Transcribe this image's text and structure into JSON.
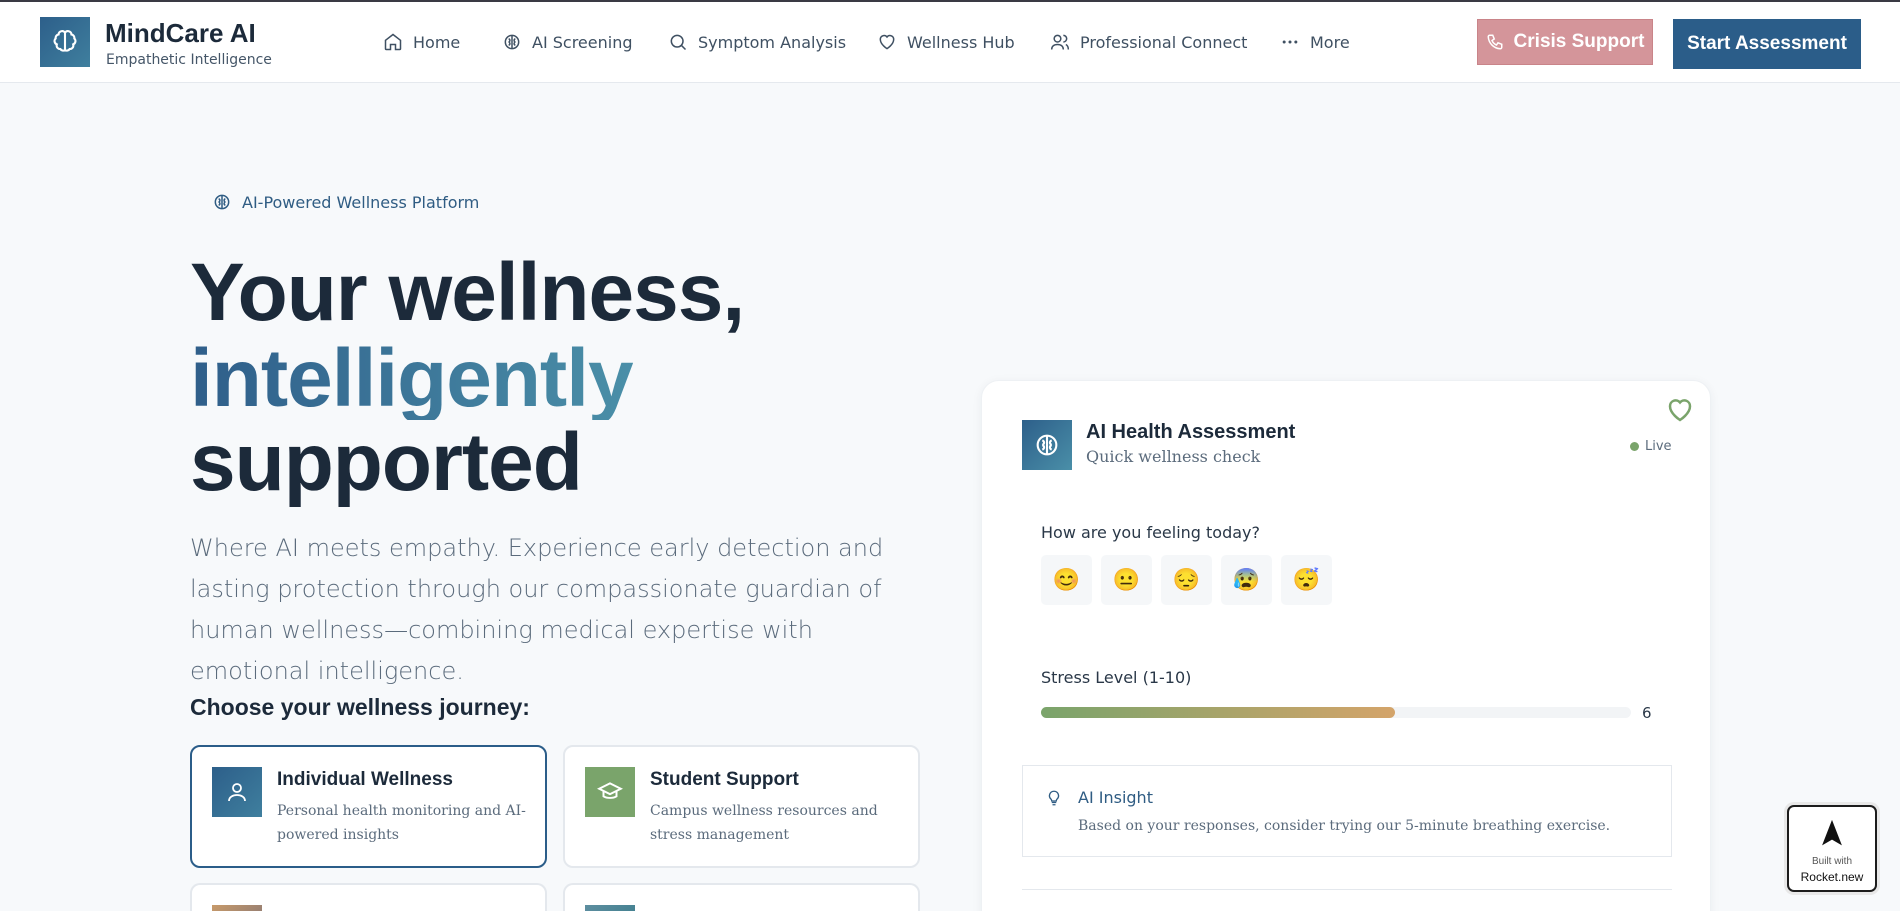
{
  "brand": {
    "name": "MindCare AI",
    "tagline": "Empathetic Intelligence"
  },
  "nav": [
    {
      "label": "Home",
      "icon": "home-icon"
    },
    {
      "label": "AI Screening",
      "icon": "brain-icon"
    },
    {
      "label": "Symptom Analysis",
      "icon": "search-icon"
    },
    {
      "label": "Wellness Hub",
      "icon": "heart-icon"
    },
    {
      "label": "Professional Connect",
      "icon": "users-icon"
    },
    {
      "label": "More",
      "icon": "more-icon"
    }
  ],
  "header_actions": {
    "crisis": "Crisis Support",
    "start": "Start Assessment"
  },
  "hero": {
    "badge": "AI-Powered Wellness Platform",
    "line1": "Your wellness,",
    "line2": "intelligently",
    "line3": "supported",
    "lead": "Where AI meets empathy. Experience early detection and lasting protection through our compassionate guardian of human wellness—combining medical expertise with emotional intelligence.",
    "choose": "Choose your wellness journey:"
  },
  "journeys": [
    {
      "title": "Individual Wellness",
      "desc": "Personal health monitoring and AI-powered insights",
      "color": "#2d5f8a"
    },
    {
      "title": "Student Support",
      "desc": "Campus wellness resources and stress management",
      "color": "#7aa46b"
    }
  ],
  "assessment": {
    "title": "AI Health Assessment",
    "subtitle": "Quick wellness check",
    "status": "Live",
    "question": "How are you feeling today?",
    "moods": [
      "😊",
      "😐",
      "😔",
      "😰",
      "😴"
    ],
    "stress_label": "Stress Level (1-10)",
    "stress_value": "6",
    "stress_fraction": 0.6,
    "insight_title": "AI Insight",
    "insight_text": "Based on your responses, consider trying our 5-minute breathing exercise."
  },
  "rocket": {
    "built": "Built with",
    "name": "Rocket.new"
  }
}
